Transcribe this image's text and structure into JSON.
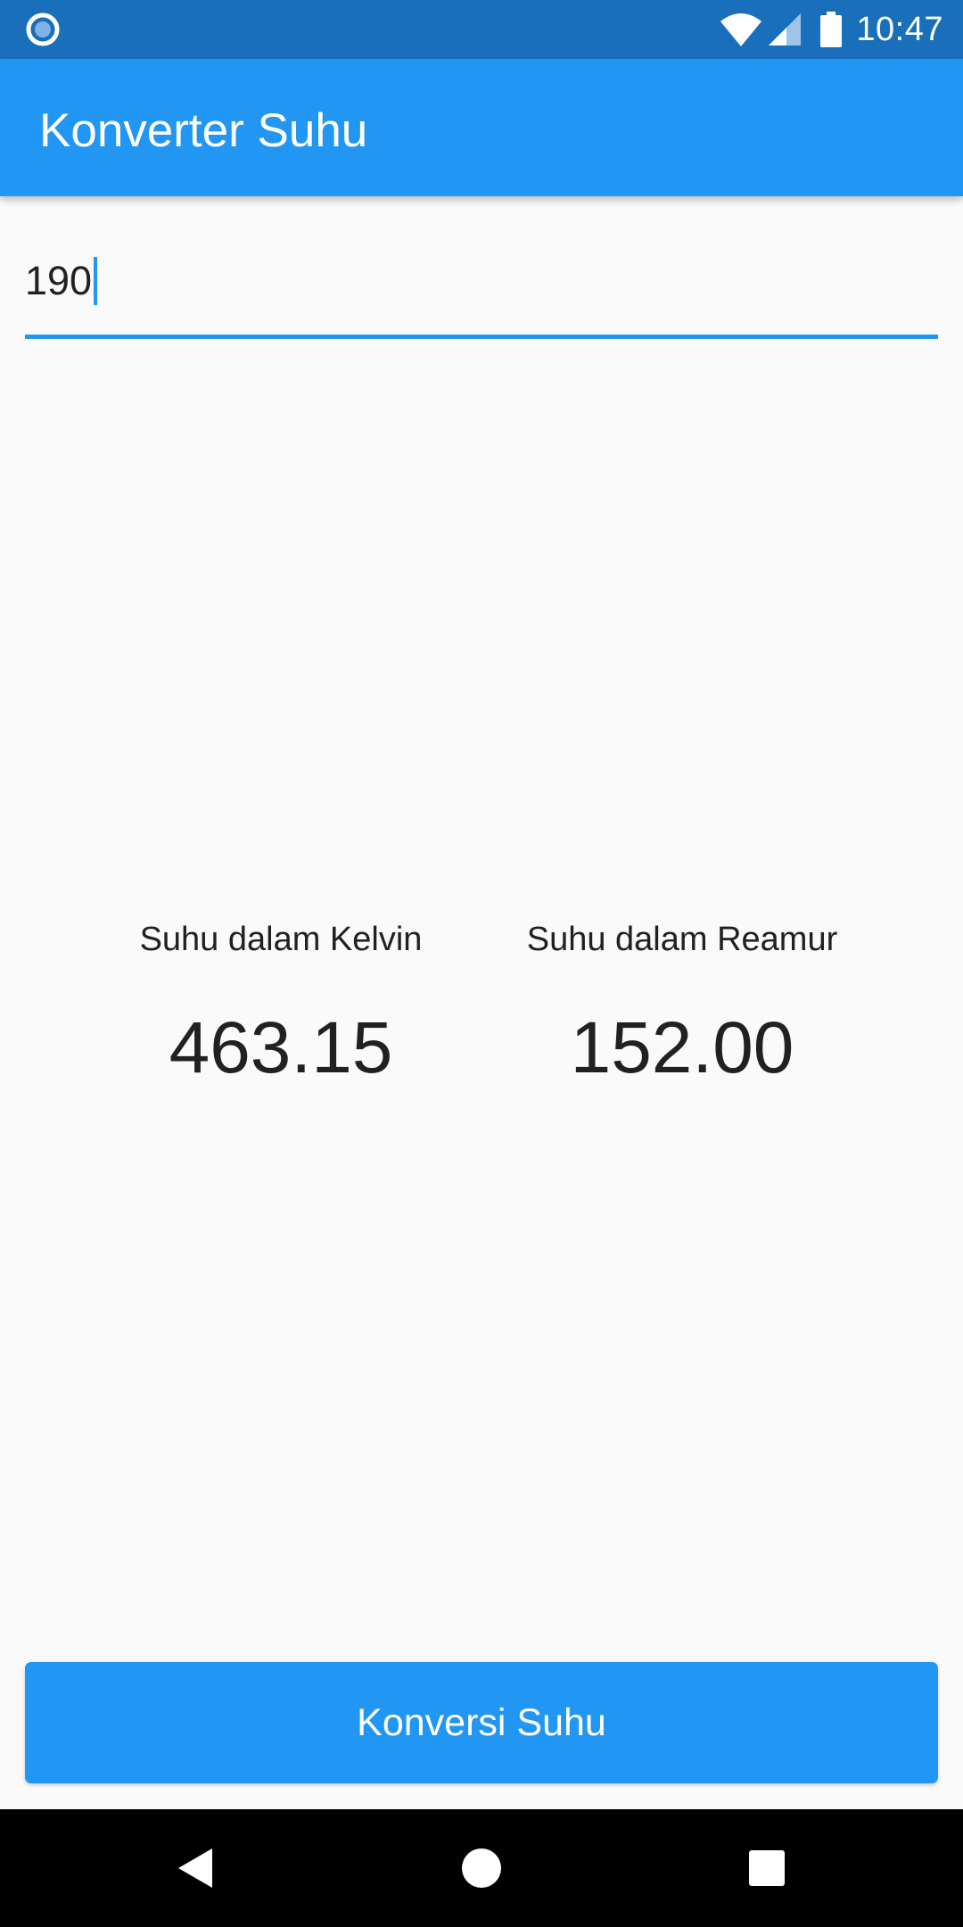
{
  "status_bar": {
    "time": "10:47",
    "icons": [
      "app-notification-icon",
      "wifi-icon",
      "signal-icon",
      "battery-icon"
    ],
    "color": "#1a6fba"
  },
  "app_bar": {
    "title": "Konverter Suhu",
    "color": "#2196f3"
  },
  "input": {
    "value": "190",
    "accent": "#2196f3"
  },
  "results": {
    "kelvin": {
      "label": "Suhu dalam Kelvin",
      "value": "463.15"
    },
    "reamur": {
      "label": "Suhu dalam Reamur",
      "value": "152.00"
    }
  },
  "convert_button": {
    "label": "Konversi Suhu",
    "color": "#2196f3"
  },
  "nav_bar": {
    "icons": [
      "back-icon",
      "home-icon",
      "recents-icon"
    ]
  }
}
